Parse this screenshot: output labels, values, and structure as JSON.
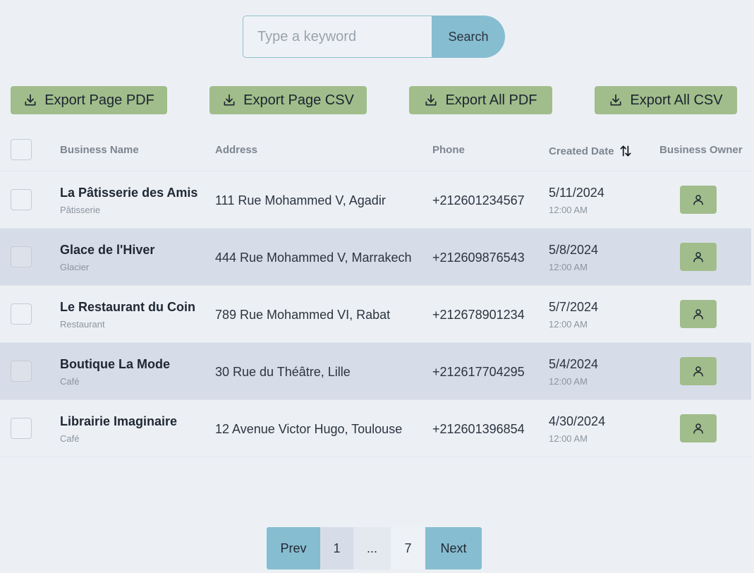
{
  "search": {
    "placeholder": "Type a keyword",
    "value": "",
    "button_label": "Search"
  },
  "exports": [
    {
      "label": "Export Page PDF"
    },
    {
      "label": "Export Page CSV"
    },
    {
      "label": "Export All PDF"
    },
    {
      "label": "Export All CSV"
    }
  ],
  "table": {
    "columns": {
      "name": "Business Name",
      "address": "Address",
      "phone": "Phone",
      "created": "Created Date",
      "owner": "Business Owner"
    },
    "rows": [
      {
        "name": "La Pâtisserie des Amis",
        "category": "Pâtisserie",
        "address": "111 Rue Mohammed V, Agadir",
        "phone": "+212601234567",
        "date": "5/11/2024",
        "time": "12:00 AM"
      },
      {
        "name": "Glace de l'Hiver",
        "category": "Glacier",
        "address": "444 Rue Mohammed V, Marrakech",
        "phone": "+212609876543",
        "date": "5/8/2024",
        "time": "12:00 AM"
      },
      {
        "name": "Le Restaurant du Coin",
        "category": "Restaurant",
        "address": "789 Rue Mohammed VI, Rabat",
        "phone": "+212678901234",
        "date": "5/7/2024",
        "time": "12:00 AM"
      },
      {
        "name": "Boutique La Mode",
        "category": "Café",
        "address": "30 Rue du Théâtre, Lille",
        "phone": "+212617704295",
        "date": "5/4/2024",
        "time": "12:00 AM"
      },
      {
        "name": "Librairie Imaginaire",
        "category": "Café",
        "address": "12 Avenue Victor Hugo, Toulouse",
        "phone": "+212601396854",
        "date": "4/30/2024",
        "time": "12:00 AM"
      }
    ]
  },
  "pagination": {
    "prev": "Prev",
    "first": "1",
    "ellipsis": "...",
    "current": "7",
    "next": "Next"
  },
  "icons": {
    "export": "download-icon",
    "sort": "sort-arrows-icon",
    "owner": "user-icon"
  },
  "colors": {
    "background": "#ecf0f5",
    "accent_blue": "#87bdd0",
    "accent_green": "#a1bd8b",
    "row_alt": "#d7dde8"
  }
}
